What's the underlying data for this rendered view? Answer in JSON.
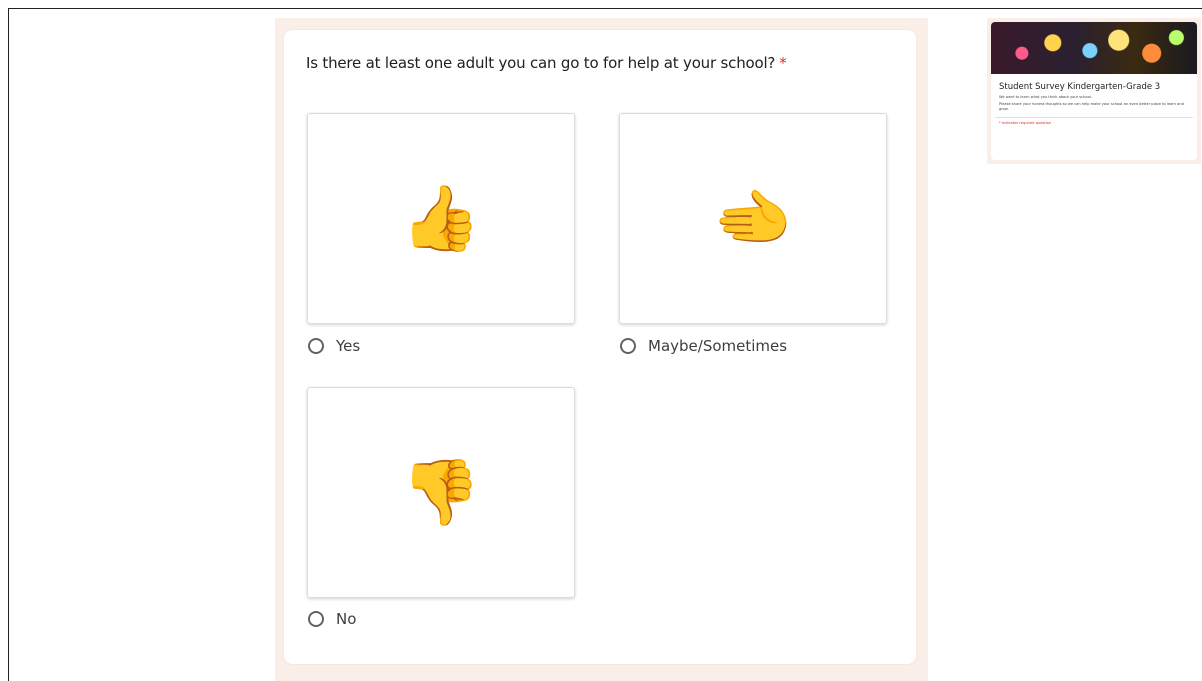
{
  "question": {
    "text": "Is there at least one adult you can go to for help at your school?",
    "required_mark": "*"
  },
  "options": [
    {
      "label": "Yes",
      "emoji": "👍",
      "icon": "thumbs-up-icon"
    },
    {
      "label": "Maybe/Sometimes",
      "emoji": "🫲",
      "icon": "sideways-thumb-icon"
    },
    {
      "label": "No",
      "emoji": "👎",
      "icon": "thumbs-down-icon"
    }
  ],
  "header_preview": {
    "title": "Student Survey Kindergarten-Grade 3",
    "description_line1": "We want to learn what you think about your school.",
    "description_line2": "Please share your honest thoughts so we can help make your school an even better place to learn and grow.",
    "required_note": "* Indicates required question"
  },
  "colors": {
    "theme_background": "#faeee8",
    "required": "#d93025",
    "radio_border": "#5f6368"
  }
}
